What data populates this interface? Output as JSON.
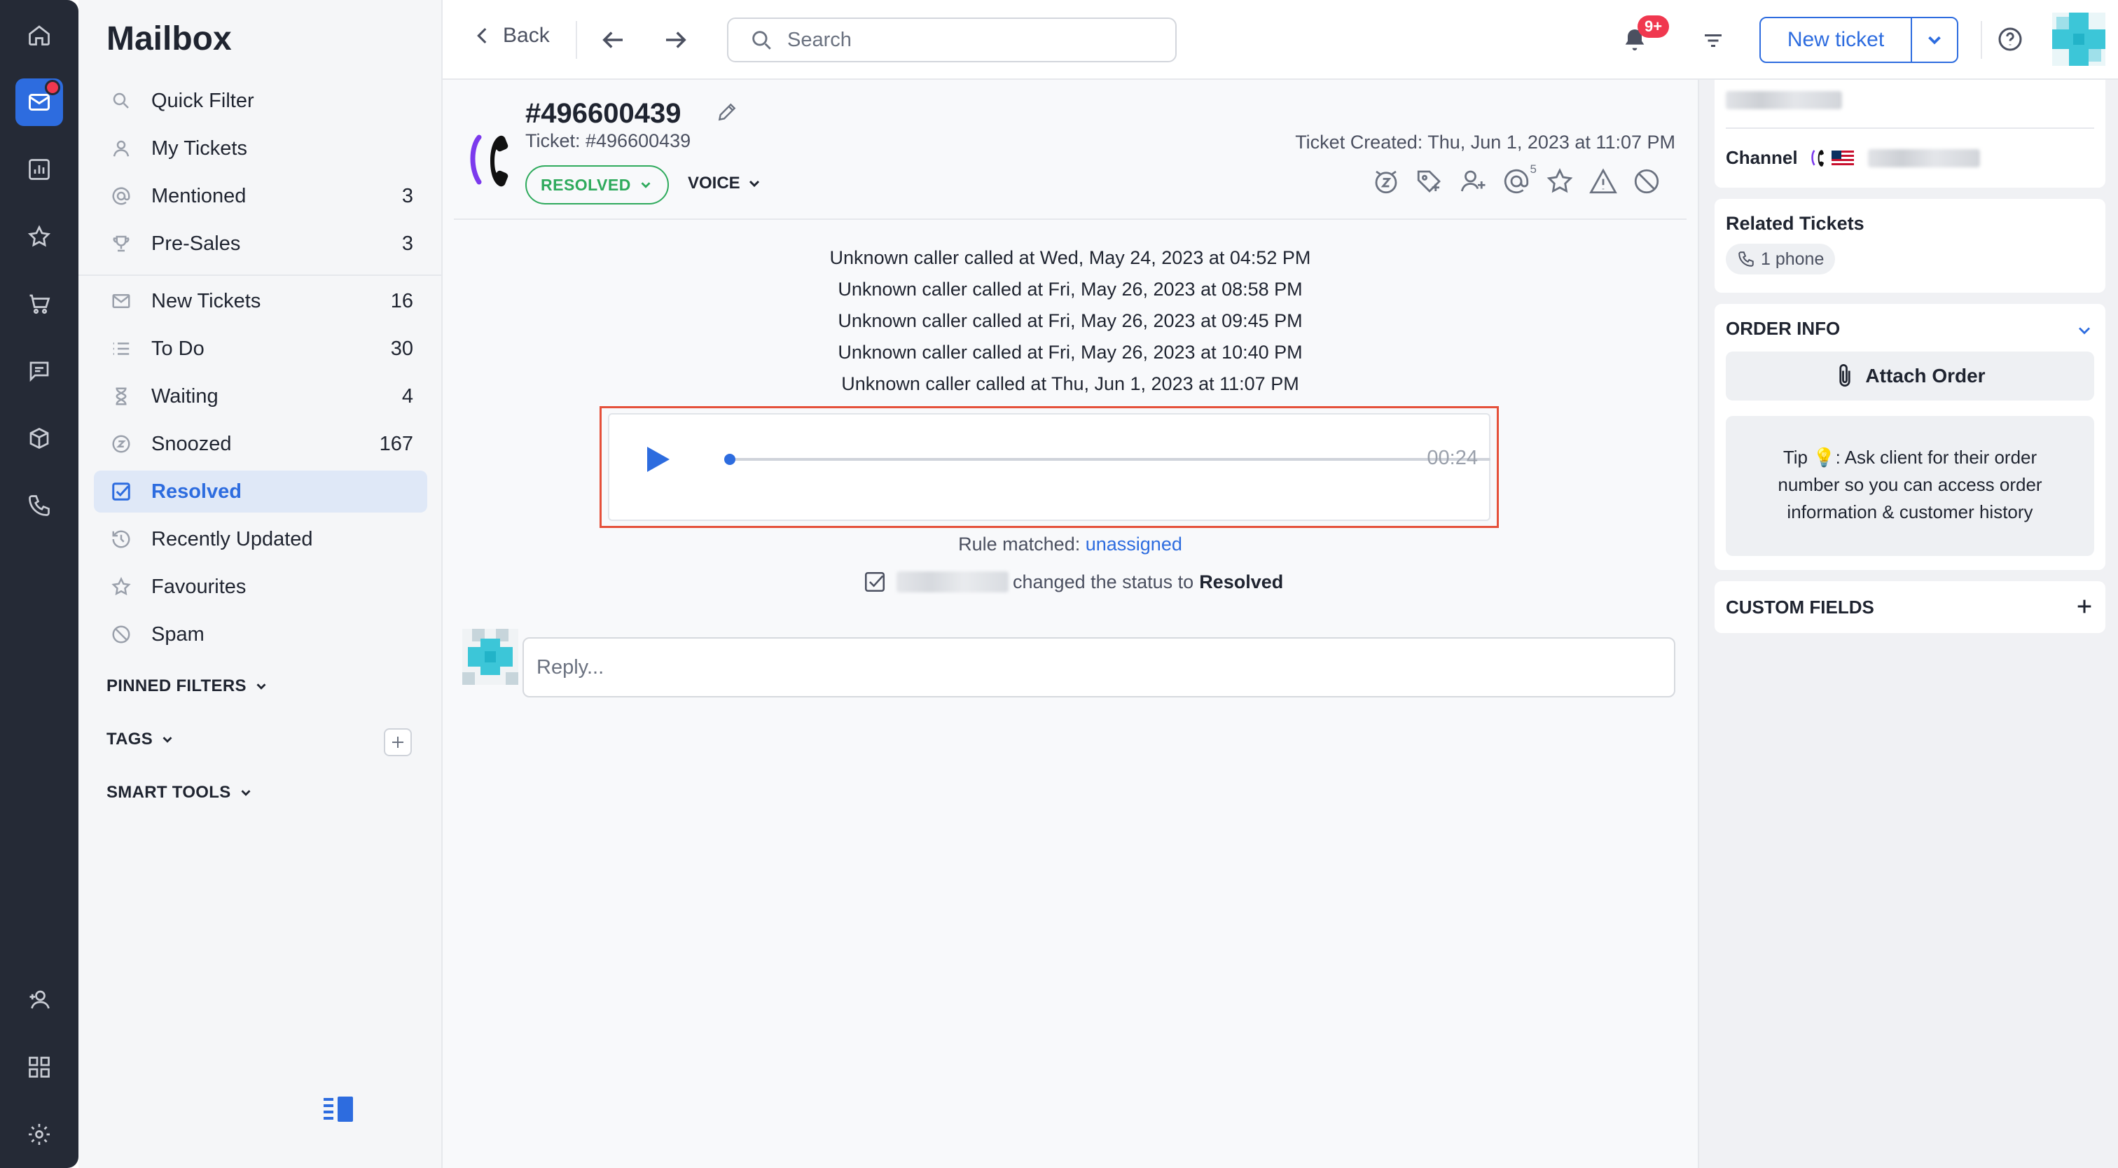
{
  "sidebar": {
    "title": "Mailbox",
    "items": [
      {
        "label": "Quick Filter",
        "count": ""
      },
      {
        "label": "My Tickets",
        "count": ""
      },
      {
        "label": "Mentioned",
        "count": "3"
      },
      {
        "label": "Pre-Sales",
        "count": "3"
      },
      {
        "label": "New Tickets",
        "count": "16"
      },
      {
        "label": "To Do",
        "count": "30"
      },
      {
        "label": "Waiting",
        "count": "4"
      },
      {
        "label": "Snoozed",
        "count": "167"
      },
      {
        "label": "Resolved",
        "count": ""
      },
      {
        "label": "Recently Updated",
        "count": ""
      },
      {
        "label": "Favourites",
        "count": ""
      },
      {
        "label": "Spam",
        "count": ""
      }
    ],
    "sections": {
      "pinned": "PINNED FILTERS",
      "tags": "TAGS",
      "smart": "SMART TOOLS"
    }
  },
  "topbar": {
    "back_label": "Back",
    "search_placeholder": "Search",
    "notification_badge": "9+",
    "new_ticket_label": "New ticket"
  },
  "ticket": {
    "title": "#496600439",
    "subtitle": "Ticket: #496600439",
    "status": "RESOLVED",
    "channel": "VOICE",
    "created": "Ticket Created: Thu, Jun 1, 2023 at 11:07 PM",
    "mentions_count": "5",
    "events": [
      "Unknown caller called at Wed, May 24, 2023 at 04:52 PM",
      "Unknown caller called at Fri, May 26, 2023 at 08:58 PM",
      "Unknown caller called at Fri, May 26, 2023 at 09:45 PM",
      "Unknown caller called at Fri, May 26, 2023 at 10:40 PM",
      "Unknown caller called at Thu, Jun 1, 2023 at 11:07 PM"
    ],
    "audio": {
      "duration": "00:24",
      "progress": 0.0
    },
    "rule_prefix": "Rule matched:",
    "rule_link": "unassigned",
    "status_change_text": "changed the status to",
    "status_change_value": "Resolved",
    "reply_placeholder": "Reply..."
  },
  "right_panel": {
    "channel_label": "Channel",
    "related_title": "Related Tickets",
    "related_chip": "1 phone",
    "order_title": "ORDER INFO",
    "attach_label": "Attach Order",
    "tip": "Tip 💡: Ask client for their order number so you can access order information & customer history",
    "custom_fields_title": "CUSTOM FIELDS"
  },
  "colors": {
    "accent": "#2d6cdf",
    "resolved_green": "#2eaa5c",
    "rail_bg": "#252a36",
    "badge_red": "#f0384f",
    "highlight_red": "#e5503a"
  }
}
